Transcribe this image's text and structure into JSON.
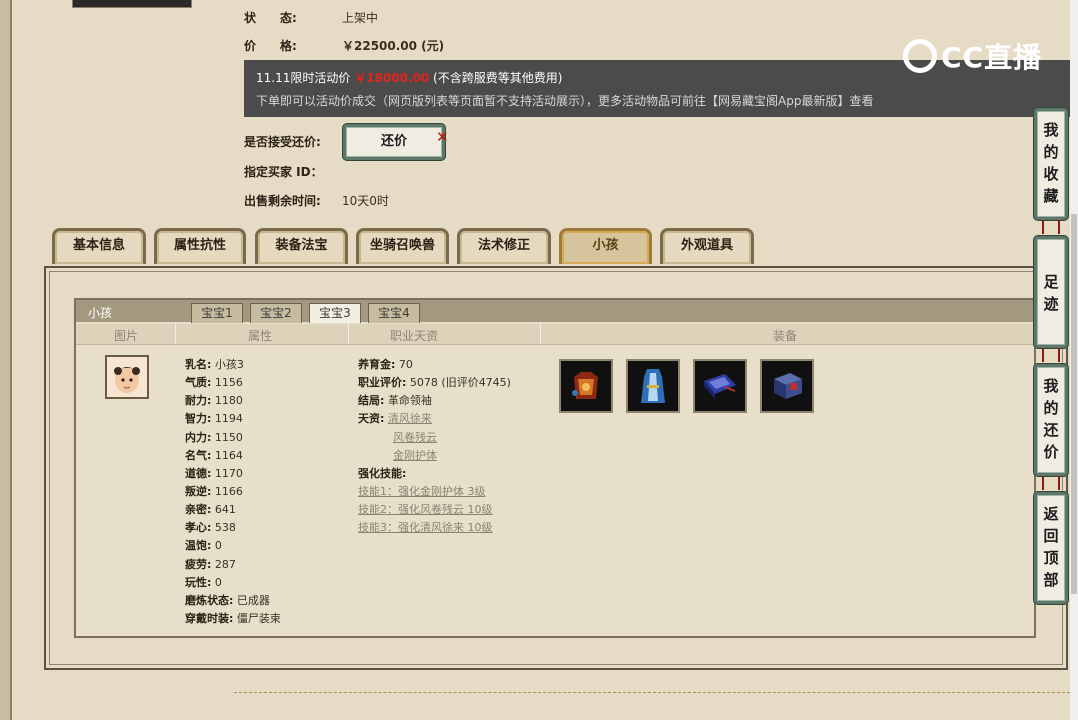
{
  "status": {
    "label": "状　　态:",
    "value": "上架中"
  },
  "price": {
    "label": "价　　格:",
    "value": "￥22500.00 (元)"
  },
  "promo": {
    "line1_title": "11.11限时活动价",
    "line1_price": "￥18000.00",
    "line1_note": "(不含跨服费等其他费用)",
    "line2": "下单即可以活动价成交（网页版列表等页面暂不支持活动展示），更多活动物品可前往【网易藏宝阁App最新版】查看"
  },
  "bargain": {
    "label": "是否接受还价:",
    "button": "还价",
    "mark": "✕"
  },
  "buyer": {
    "label": "指定买家 ID："
  },
  "remaining": {
    "label": "出售剩余时间:",
    "value": "10天0时"
  },
  "logo": {
    "text": "CC直播"
  },
  "tabs": [
    {
      "label": "基本信息"
    },
    {
      "label": "属性抗性"
    },
    {
      "label": "装备法宝"
    },
    {
      "label": "坐骑召唤兽"
    },
    {
      "label": "法术修正"
    },
    {
      "label": "小孩"
    },
    {
      "label": "外观道具"
    }
  ],
  "child_panel": {
    "title": "小孩",
    "subtabs": [
      "宝宝1",
      "宝宝2",
      "宝宝3",
      "宝宝4"
    ],
    "columns": [
      "图片",
      "属性",
      "职业天资",
      "装备"
    ],
    "attributes": [
      {
        "k": "乳名:",
        "v": "小孩3"
      },
      {
        "k": "气质:",
        "v": "1156"
      },
      {
        "k": "耐力:",
        "v": "1180"
      },
      {
        "k": "智力:",
        "v": "1194"
      },
      {
        "k": "内力:",
        "v": "1150"
      },
      {
        "k": "名气:",
        "v": "1164"
      },
      {
        "k": "道德:",
        "v": "1170"
      },
      {
        "k": "叛逆:",
        "v": "1166"
      },
      {
        "k": "亲密:",
        "v": "641"
      },
      {
        "k": "孝心:",
        "v": "538"
      },
      {
        "k": "温饱:",
        "v": "0"
      },
      {
        "k": "疲劳:",
        "v": "287"
      },
      {
        "k": "玩性:",
        "v": "0"
      },
      {
        "k": "磨炼状态:",
        "v": "已成器"
      },
      {
        "k": "穿戴时装:",
        "v": "僵尸装束"
      }
    ],
    "career": {
      "raise_money": {
        "k": "养育金:",
        "v": "70"
      },
      "rating": {
        "k": "职业评价:",
        "v": "5078 (旧评价4745)"
      },
      "ending": {
        "k": "结局:",
        "v": "革命领袖"
      },
      "talent_label": "天资:",
      "talents": [
        "清风徐来",
        "风卷残云",
        "金刚护体"
      ],
      "skills_label": "强化技能:",
      "skills": [
        "技能1：强化金刚护体 3级",
        "技能2：强化风卷残云 10级",
        "技能3：强化清风徐来 10级"
      ]
    },
    "equipment_count": 4
  },
  "side_buttons": [
    {
      "label": "我的收藏"
    },
    {
      "label": "足迹"
    },
    {
      "label": "我的还价"
    },
    {
      "label": "返回顶部"
    }
  ]
}
